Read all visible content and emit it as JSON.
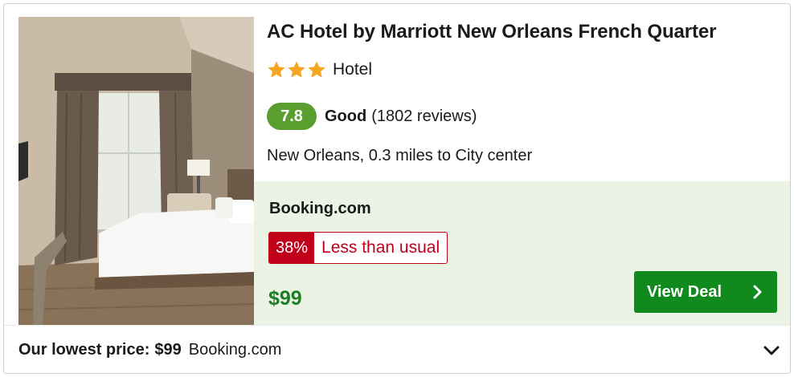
{
  "hotel": {
    "name": "AC Hotel by Marriott New Orleans French Quarter",
    "star_count": 3,
    "type": "Hotel",
    "rating": {
      "score": "7.8",
      "label": "Good",
      "reviews": "(1802 reviews)"
    },
    "location": "New Orleans, 0.3 miles to City center"
  },
  "deal": {
    "provider": "Booking.com",
    "discount_pct": "38%",
    "discount_text": "Less than usual",
    "price": "$99",
    "cta_label": "View Deal"
  },
  "footer": {
    "lowest_label": "Our lowest price:",
    "lowest_price": "$99",
    "lowest_provider": "Booking.com"
  },
  "colors": {
    "score_bg": "#5a9e2f",
    "deal_bg": "#ebf4e4",
    "price_green": "#1b7f24",
    "cta_green": "#108a1c",
    "discount_red": "#c0001a",
    "star_orange": "#f5a623"
  },
  "icons": {
    "star": "star-icon",
    "cta": "chevron-right-icon",
    "expand": "chevron-down-icon"
  }
}
